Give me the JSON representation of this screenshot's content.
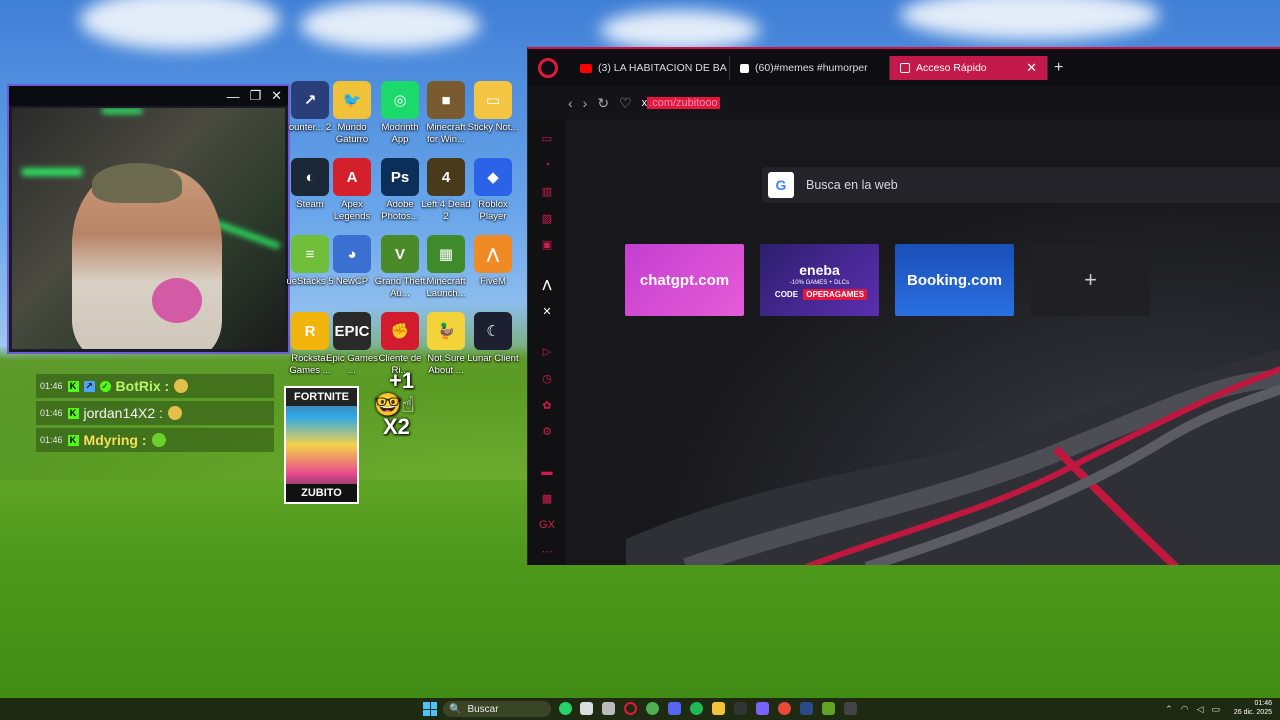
{
  "webcam": {
    "window_controls": [
      "—",
      "❐",
      "✕"
    ]
  },
  "chat": [
    {
      "time": "01:46",
      "name": "BotRix :",
      "style": "green"
    },
    {
      "time": "01:46",
      "name": "jordan14X2 :",
      "style": "white"
    },
    {
      "time": "01:46",
      "name": "Mdyring :",
      "style": "green"
    }
  ],
  "desktop_icons": [
    {
      "label": "ounter... 2",
      "color": "#2a3f7a",
      "glyph": "↗"
    },
    {
      "label": "Mundo Gaturro",
      "color": "#f0c23a",
      "glyph": "🐦"
    },
    {
      "label": "Modrinth App",
      "color": "#1bd96a",
      "glyph": "◎"
    },
    {
      "label": "Minecraft for Win...",
      "color": "#7a5a2f",
      "glyph": "■"
    },
    {
      "label": "Sticky Not...",
      "color": "#f4c542",
      "glyph": "▭"
    },
    {
      "label": "Steam",
      "color": "#1b2838",
      "glyph": "◐"
    },
    {
      "label": "Apex Legends",
      "color": "#d3202a",
      "glyph": "A"
    },
    {
      "label": "Adobe Photos...",
      "color": "#0c2f5a",
      "glyph": "Ps"
    },
    {
      "label": "Left 4 Dead 2",
      "color": "#4a3a1c",
      "glyph": "4"
    },
    {
      "label": "Roblox Player",
      "color": "#2a63e8",
      "glyph": "◆"
    },
    {
      "label": "ueStacks 5",
      "color": "#6fbf3a",
      "glyph": "≡"
    },
    {
      "label": "NewCP",
      "color": "#3b6fd0",
      "glyph": "◕"
    },
    {
      "label": "Grand Theft Au...",
      "color": "#4a8a2a",
      "glyph": "V"
    },
    {
      "label": "Minecraft Launch...",
      "color": "#3f8a2a",
      "glyph": "▦"
    },
    {
      "label": "FiveM",
      "color": "#f08a24",
      "glyph": "⋀"
    },
    {
      "label": "Rockstar Games ...",
      "color": "#f2b40b",
      "glyph": "R"
    },
    {
      "label": "Epic Games ...",
      "color": "#2a2a2a",
      "glyph": "EPIC"
    },
    {
      "label": "Cliente de Ri...",
      "color": "#d31b2e",
      "glyph": "✊"
    },
    {
      "label": "Not Sure About ...",
      "color": "#f4d23a",
      "glyph": "🦆"
    },
    {
      "label": "Lunar Client",
      "color": "#1c2030",
      "glyph": "☾"
    }
  ],
  "fortnite": {
    "title": "FORTNITE",
    "footer": "ZUBITO"
  },
  "overlay": {
    "plus1": "+1",
    "x2": "X2"
  },
  "browser": {
    "tabs": [
      {
        "label": "(3) LA HABITACION DE BA",
        "icon_color": "#ff0000"
      },
      {
        "label": "(60)#memes #humorper",
        "icon_color": "#ffffff"
      },
      {
        "label": "Acceso Rápido",
        "icon_color": "#ffffff",
        "active": true
      }
    ],
    "new_tab": "+",
    "url_prefix": "x",
    "url_highlight": ".com/zubitooo",
    "search_badge": "G",
    "search_placeholder": "Busca en la web",
    "tiles": {
      "chatgpt": "chatgpt.com",
      "eneba_brand": "eneba",
      "eneba_promo": "-10% GAMES + DLCs",
      "eneba_code_label": "CODE",
      "eneba_code": "OPERAGAMES",
      "booking": "Booking.com",
      "add": "+"
    },
    "accent": "#e3173e"
  },
  "taskbar": {
    "search": "Buscar",
    "time": "01:46",
    "date": "26 dic. 2025"
  }
}
